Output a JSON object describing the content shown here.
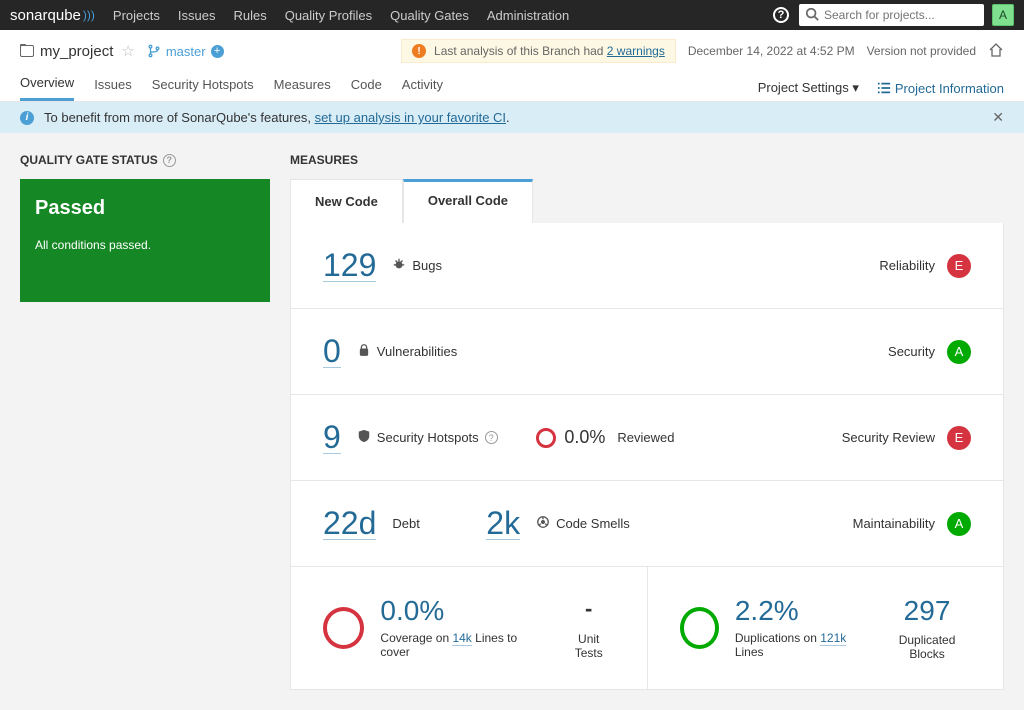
{
  "topbar": {
    "brand_left": "sonar",
    "brand_right": "qube",
    "nav": [
      "Projects",
      "Issues",
      "Rules",
      "Quality Profiles",
      "Quality Gates",
      "Administration"
    ],
    "search_placeholder": "Search for projects...",
    "avatar_initial": "A"
  },
  "project": {
    "name": "my_project",
    "branch": "master",
    "warning_prefix": "Last analysis of this Branch had ",
    "warning_link": "2 warnings",
    "timestamp": "December 14, 2022 at 4:52 PM",
    "version": "Version not provided",
    "tabs": [
      "Overview",
      "Issues",
      "Security Hotspots",
      "Measures",
      "Code",
      "Activity"
    ],
    "settings_label": "Project Settings",
    "info_label": "Project Information"
  },
  "infobar": {
    "text": "To benefit from more of SonarQube's features, ",
    "link": "set up analysis in your favorite CI"
  },
  "qg": {
    "section": "QUALITY GATE STATUS",
    "status": "Passed",
    "detail": "All conditions passed."
  },
  "measures": {
    "section": "MEASURES",
    "tab_new": "New Code",
    "tab_overall": "Overall Code",
    "bugs": {
      "value": "129",
      "label": "Bugs",
      "category": "Reliability",
      "rating": "E"
    },
    "vulns": {
      "value": "0",
      "label": "Vulnerabilities",
      "category": "Security",
      "rating": "A"
    },
    "hotspots": {
      "value": "9",
      "label": "Security Hotspots",
      "reviewed_pct": "0.0%",
      "reviewed_label": "Reviewed",
      "category": "Security Review",
      "rating": "E"
    },
    "debt": {
      "value": "22d",
      "label": "Debt",
      "smells": "2k",
      "smells_label": "Code Smells",
      "category": "Maintainability",
      "rating": "A"
    },
    "coverage": {
      "pct": "0.0%",
      "sub_prefix": "Coverage on ",
      "lines": "14k",
      "sub_suffix": " Lines to cover",
      "unit_dash": "-",
      "unit_label": "Unit Tests"
    },
    "dup": {
      "pct": "2.2%",
      "sub_prefix": "Duplications on ",
      "lines": "121k",
      "sub_suffix": " Lines",
      "blocks": "297",
      "blocks_label": "Duplicated Blocks"
    }
  }
}
